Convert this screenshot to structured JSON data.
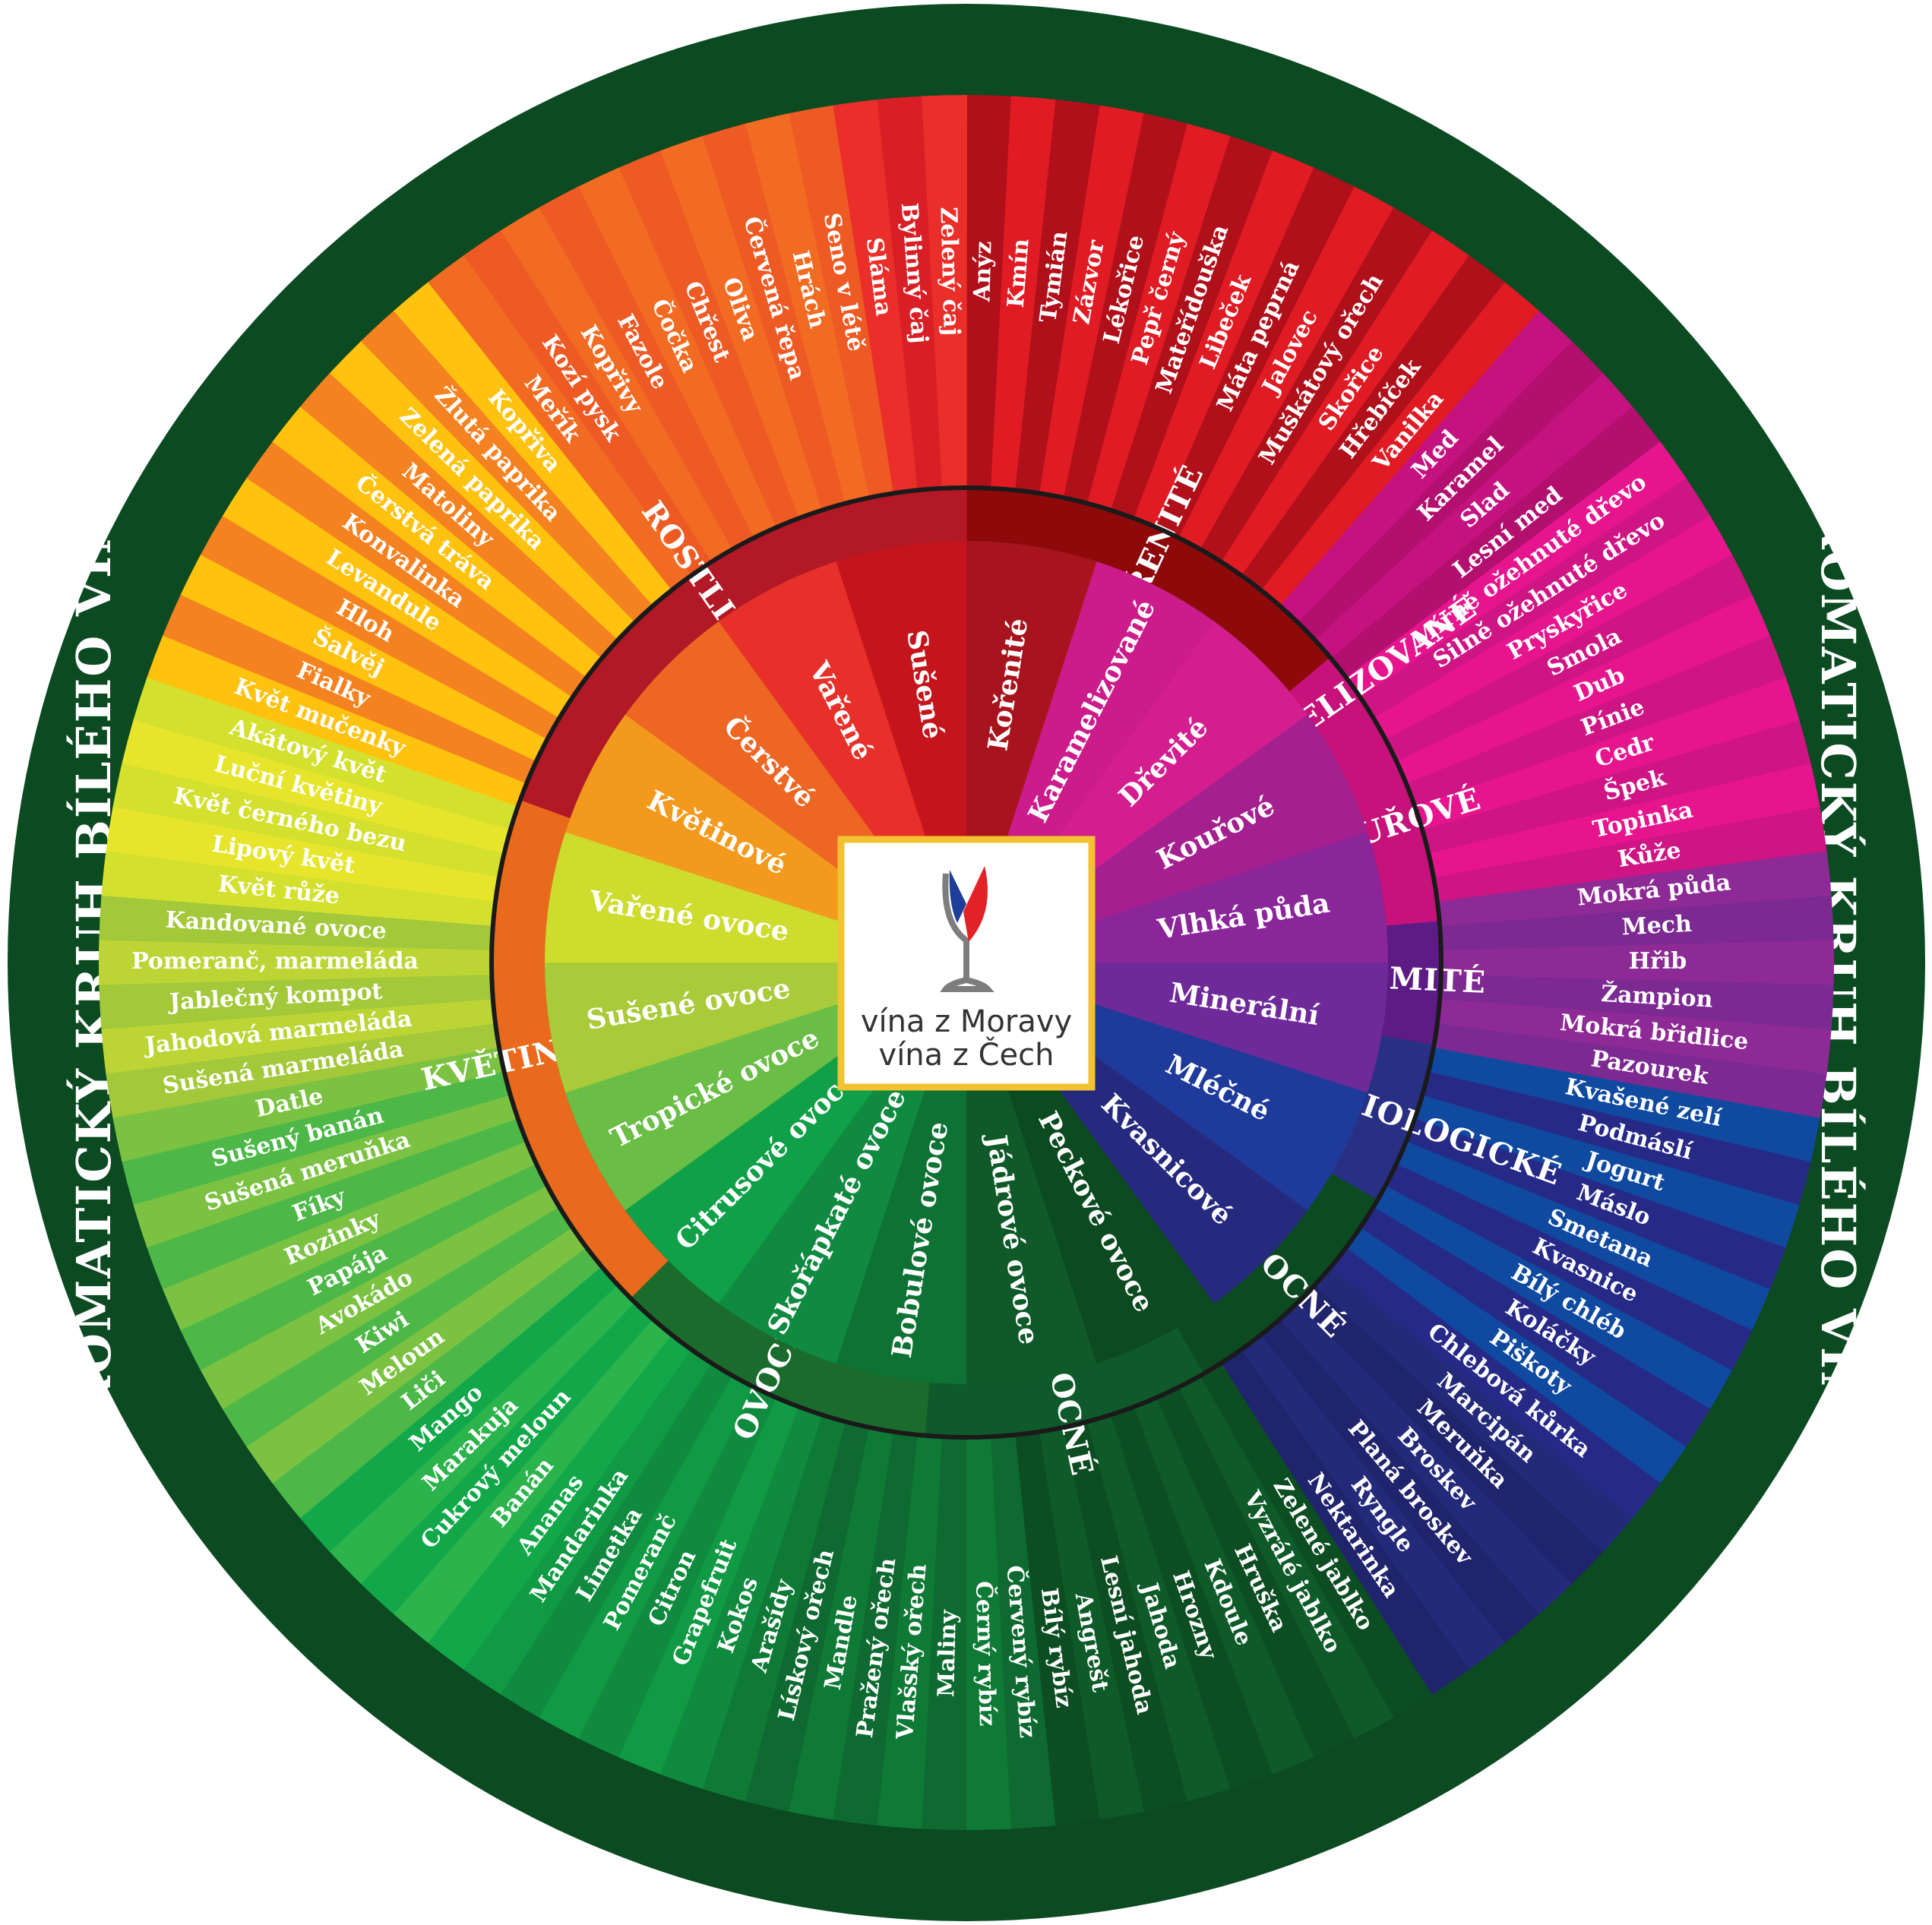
{
  "title": "AROMATICKÝ KRUH BÍLÉHO VÍNA",
  "logo": {
    "line1": "vína z Moravy",
    "line2": "vína z Čech"
  },
  "colors": {
    "frame": "#0c4a22",
    "band": "#0e3e1c",
    "ring_line": "#1a1a1a",
    "logo_border": "#f2c230",
    "logo_flag_blue": "#1d3f9a",
    "logo_flag_red": "#e32227",
    "logo_glass": "#7d7d7d"
  },
  "categories": [
    {
      "label": "KOŘENITÉ",
      "color": "#8e0a0a"
    },
    {
      "label": "KAMARELIZOVANÉ",
      "color": "#c6127a"
    },
    {
      "label": "KOUŘOVÉ",
      "color": "#c6127a"
    },
    {
      "label": "ZEMITÉ",
      "color": "#5c1b85"
    },
    {
      "label": "MIKROBIOLOGICKÉ",
      "color": "#283084"
    },
    {
      "label": "OVOCNÉ",
      "color": "#0c4a22"
    },
    {
      "label": "OVOCNÉ",
      "color": "#0f5a2a"
    },
    {
      "label": "OVOCNÉ",
      "color": "#1b6c2c"
    },
    {
      "label": "KVĚTINOVÉ",
      "color": "#e96a1c"
    },
    {
      "label": "ROSTLINNÉ",
      "color": "#b21826"
    }
  ],
  "subcategories": [
    {
      "label": "Kořenité",
      "color": "#a8141d"
    },
    {
      "label": "Karamelizované",
      "color": "#cc1b8a"
    },
    {
      "label": "Dřevité",
      "color": "#d41e8f"
    },
    {
      "label": "Kouřové",
      "color": "#a5208f"
    },
    {
      "label": "Vlhká půda",
      "color": "#8a259a"
    },
    {
      "label": "Minerální",
      "color": "#6f2a9a"
    },
    {
      "label": "Mléčné",
      "color": "#1e3a9a"
    },
    {
      "label": "Kvasnicové",
      "color": "#262a7e"
    },
    {
      "label": "Peckové ovoce",
      "color": "#0c4a20"
    },
    {
      "label": "Jádrové ovoce",
      "color": "#0f5a28"
    },
    {
      "label": "Bobulové ovoce",
      "color": "#0e7234"
    },
    {
      "label": "Skořápkaté ovoce",
      "color": "#0f8a40"
    },
    {
      "label": "Citrusové ovoce",
      "color": "#0fa048"
    },
    {
      "label": "Tropické ovoce",
      "color": "#6abd45"
    },
    {
      "label": "Sušené ovoce",
      "color": "#a9cb3a"
    },
    {
      "label": "Vařené ovoce",
      "color": "#cddc2d"
    },
    {
      "label": "Květinové",
      "color": "#f39a1e"
    },
    {
      "label": "Čerstvé",
      "color": "#ee6624"
    },
    {
      "label": "Vařené",
      "color": "#e8302a"
    },
    {
      "label": "Sušené",
      "color": "#c4151c"
    }
  ],
  "aromas": [
    "Anýz",
    "Kmín",
    "Tymián",
    "Zázvor",
    "Lékořice",
    "Pepř černý",
    "Mateřídouška",
    "Libeček",
    "Máta peprná",
    "Jalovec",
    "Muškátový ořech",
    "Skořice",
    "Hřebíček",
    "Vanilka",
    "Med",
    "Karamel",
    "Slad",
    "Lesní med",
    "Mírně ožehnuté dřevo",
    "Silně ožehnuté dřevo",
    "Pryskyřice",
    "Smola",
    "Dub",
    "Pínie",
    "Cedr",
    "Špek",
    "Topinka",
    "Kůže",
    "Mokrá půda",
    "Mech",
    "Hřib",
    "Žampion",
    "Mokrá břidlice",
    "Pazourek",
    "Kvašené zelí",
    "Podmáslí",
    "Jogurt",
    "Máslo",
    "Smetana",
    "Kvasnice",
    "Bílý chléb",
    "Koláčky",
    "Piškoty",
    "Chlebová kůrka",
    "Marcipán",
    "Meruňka",
    "Broskev",
    "Planá broskev",
    "Ryngle",
    "Nektarinka",
    "Zelené jablko",
    "Vyzrálé jablko",
    "Hruška",
    "Kdoule",
    "Hrozny",
    "Jahoda",
    "Lesní jahoda",
    "Angrešt",
    "Bílý rybíz",
    "Červený rybíz",
    "Černý rybíz",
    "Maliny",
    "Vlašský ořech",
    "Pražený ořech",
    "Mandle",
    "Lískový ořech",
    "Arašídy",
    "Kokos",
    "Grapefruit",
    "Citron",
    "Pomeranč",
    "Limetka",
    "Mandarinka",
    "Ananas",
    "Banán",
    "Cukrový meloun",
    "Marakuja",
    "Mango",
    "Liči",
    "Meloun",
    "Kiwi",
    "Avokádo",
    "Papája",
    "Rozinky",
    "Fíky",
    "Sušená meruňka",
    "Sušený banán",
    "Datle",
    "Sušená marmeláda",
    "Jahodová marmeláda",
    "Jablečný kompot",
    "Pomeranč, marmeláda",
    "Kandované ovoce",
    "Květ růže",
    "Lipový květ",
    "Květ černého bezu",
    "Luční květiny",
    "Akátový květ",
    "Květ mučenky",
    "Fialky",
    "Šalvěj",
    "Hloh",
    "Levandule",
    "Konvalinka",
    "Čerstvá tráva",
    "Matoliny",
    "Zelená paprika",
    "Žlutá paprika",
    "Kopřiva",
    "Meřík",
    "Kozí pysk",
    "Kopřivy",
    "Fazole",
    "Čočka",
    "Chřest",
    "Oliva",
    "Červená řepa",
    "Hrách",
    "Seno v létě",
    "Sláma",
    "Bylinný čaj",
    "Zelený čaj"
  ]
}
